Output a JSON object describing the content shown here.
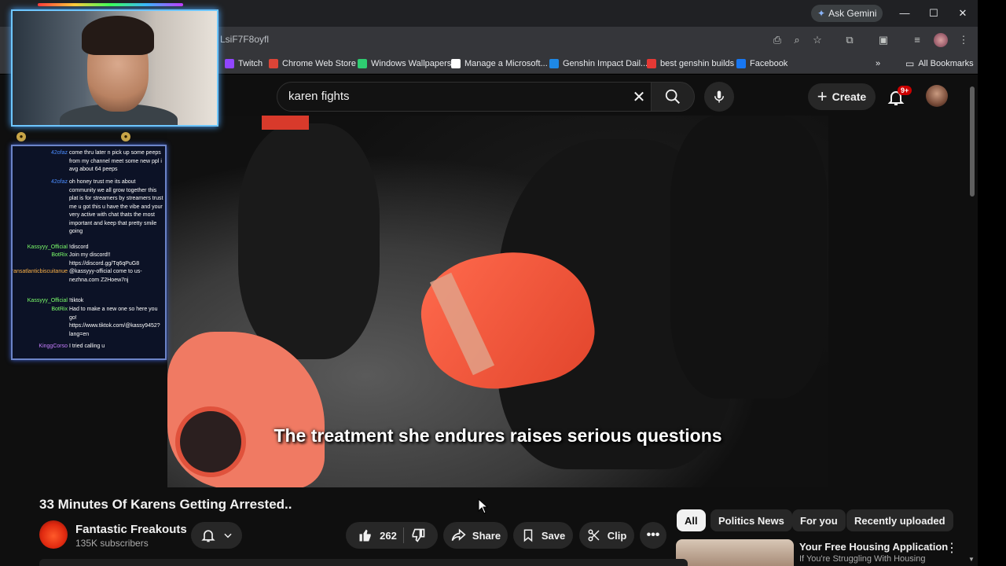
{
  "browser": {
    "url_fragment": "LsiF7F8oyfl",
    "ask_gemini": "Ask Gemini",
    "bookmarks": [
      {
        "label": "Twitch",
        "color": "#9146ff"
      },
      {
        "label": "Chrome Web Store",
        "color": "#db4437"
      },
      {
        "label": "Windows Wallpapers",
        "color": "#2ecc71"
      },
      {
        "label": "Manage a Microsoft...",
        "color": "#ffffff"
      },
      {
        "label": "Genshin Impact Dail...",
        "color": "#1e88e5"
      },
      {
        "label": "best genshin builds",
        "color": "#e53935"
      },
      {
        "label": "Facebook",
        "color": "#1877f2"
      }
    ],
    "more_bookmarks": "»",
    "all_bookmarks": "All Bookmarks"
  },
  "youtube": {
    "search_query": "karen fights",
    "create_label": "Create",
    "notif_badge": "9+"
  },
  "video": {
    "caption": "The treatment she endures raises serious questions",
    "title": "33 Minutes Of Karens Getting Arrested..",
    "channel_name": "Fantastic Freakouts",
    "subscribers": "135K subscribers",
    "likes": "262",
    "share_label": "Share",
    "save_label": "Save",
    "clip_label": "Clip"
  },
  "sidebar": {
    "chips": [
      "All",
      "Politics News",
      "For you",
      "Recently uploaded"
    ],
    "rec_title": "Your Free Housing Application",
    "rec_subtitle": "If You're Struggling With Housing"
  },
  "stream_chat": [
    {
      "user": "42ofaz",
      "user_color": "#4a8cff",
      "msg": "come thru later n pick up some peeps from my channel meet some new ppl i avg about 64 peeps"
    },
    {
      "user": "42ofaz",
      "user_color": "#4a8cff",
      "msg": "oh honey trust me its about community we all grow together this plat is for streamers by streamers trust me u got this u have the vibe and your very active with chat thats the most important and keep that pretty smile going"
    },
    {
      "user": "Kassyyy_Official",
      "user_color": "#7cff6b",
      "msg": "!discord"
    },
    {
      "user": "BotRix",
      "user_color": "#7cff6b",
      "msg": "Join my discord!! https://discord.gg/Tq6qPuG8"
    },
    {
      "user": "transatlanticbiscuitanue",
      "user_color": "#ffb347",
      "msg": "@kassyyy-official come to us-nezhna.com Z2Hoew7nj"
    },
    {
      "user": "Kassyyy_Official",
      "user_color": "#7cff6b",
      "msg": "!tiktok"
    },
    {
      "user": "BotRix",
      "user_color": "#7cff6b",
      "msg": "Had to make a new one so here you go! https://www.tiktok.com/@kassy9452?lang=en"
    },
    {
      "user": "KinggCorso",
      "user_color": "#c77dff",
      "msg": "I tried calling u"
    }
  ]
}
